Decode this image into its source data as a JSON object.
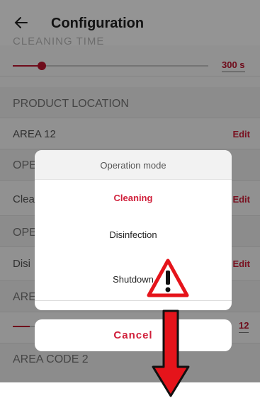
{
  "app": {
    "title": "Configuration",
    "back_icon": "back-arrow-icon"
  },
  "top_cut_label": "CLEANING TIME",
  "slider_top": {
    "value_label": "300 s",
    "fill_fraction": 0.15
  },
  "rows": {
    "product_location": "PRODUCT LOCATION",
    "area12": "AREA 12",
    "ope1": "OPE",
    "clea": "Clea",
    "ope2": "OPE",
    "disi": "Disi",
    "are": "ARE",
    "area_code2": "AREA CODE 2"
  },
  "edit_label": "Edit",
  "slider_bottom": {
    "value_label": "12",
    "fill_fraction": 0.08
  },
  "dialog": {
    "title": "Operation mode",
    "options": [
      "Cleaning",
      "Disinfection",
      "Shutdown"
    ],
    "selected": "Cleaning",
    "cancel": "Cancel"
  },
  "annotations": {
    "warning_icon": "warning-icon",
    "down_arrow": "arrow-down-icon"
  },
  "colors": {
    "accent": "#d01f3a",
    "arrow_red": "#e5141b"
  }
}
